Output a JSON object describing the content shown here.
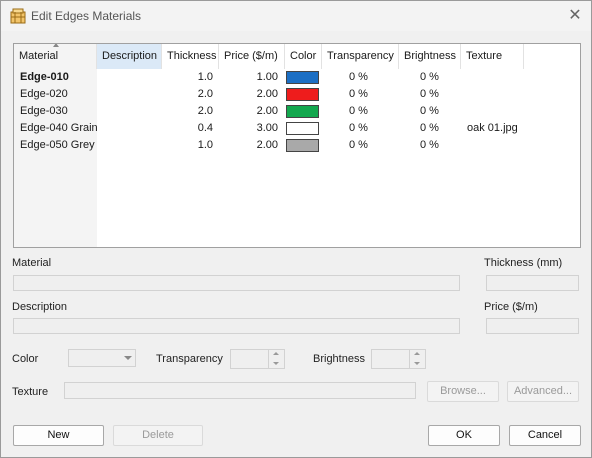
{
  "window": {
    "title": "Edit Edges Materials"
  },
  "grid": {
    "columns": [
      "Material",
      "Description",
      "Thickness",
      "Price ($/m)",
      "Color",
      "Transparency",
      "Brightness",
      "Texture"
    ],
    "rows": [
      {
        "material": "Edge-010",
        "description": "",
        "thickness": "1.0",
        "price": "1.00",
        "color": "#1c6fc4",
        "transparency": "0 %",
        "brightness": "0 %",
        "texture": ""
      },
      {
        "material": "Edge-020",
        "description": "",
        "thickness": "2.0",
        "price": "2.00",
        "color": "#ee1c1c",
        "transparency": "0 %",
        "brightness": "0 %",
        "texture": ""
      },
      {
        "material": "Edge-030",
        "description": "",
        "thickness": "2.0",
        "price": "2.00",
        "color": "#13a84e",
        "transparency": "0 %",
        "brightness": "0 %",
        "texture": ""
      },
      {
        "material": "Edge-040 Grain",
        "description": "",
        "thickness": "0.4",
        "price": "3.00",
        "color": "#ffffff",
        "transparency": "0 %",
        "brightness": "0 %",
        "texture": "oak 01.jpg"
      },
      {
        "material": "Edge-050 Grey",
        "description": "",
        "thickness": "1.0",
        "price": "2.00",
        "color": "#a9a9a9",
        "transparency": "0 %",
        "brightness": "0 %",
        "texture": ""
      }
    ]
  },
  "form": {
    "material_label": "Material",
    "thickness_label": "Thickness (mm)",
    "description_label": "Description",
    "price_label": "Price ($/m)",
    "color_label": "Color",
    "transparency_label": "Transparency",
    "brightness_label": "Brightness",
    "texture_label": "Texture",
    "browse_label": "Browse...",
    "advanced_label": "Advanced..."
  },
  "buttons": {
    "new": "New",
    "delete": "Delete",
    "ok": "OK",
    "cancel": "Cancel"
  },
  "icons": {
    "app": "materials-icon",
    "close": "close-icon"
  }
}
